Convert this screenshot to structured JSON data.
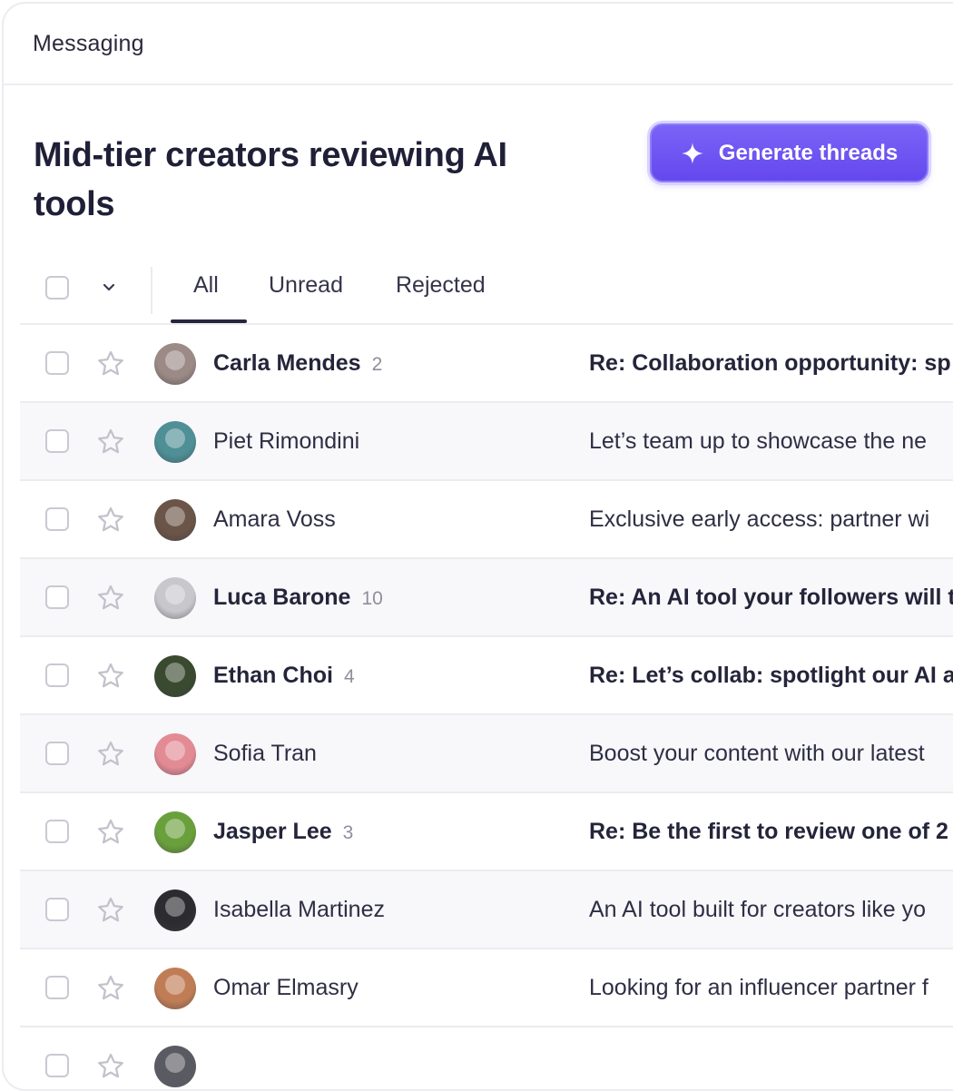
{
  "header": {
    "title": "Messaging"
  },
  "page": {
    "heading": "Mid-tier creators reviewing AI tools",
    "generate_label": "Generate threads"
  },
  "tabs": [
    {
      "label": "All",
      "active": true
    },
    {
      "label": "Unread",
      "active": false
    },
    {
      "label": "Rejected",
      "active": false
    }
  ],
  "accent": "#6a50f0",
  "threads": [
    {
      "name": "Carla Mendes",
      "count": "2",
      "unread": true,
      "subject": "Re: Collaboration opportunity: sp",
      "avatar_color": "#9b8a86"
    },
    {
      "name": "Piet Rimondini",
      "count": "",
      "unread": false,
      "subject": "Let’s team up to showcase the ne",
      "avatar_color": "#4f8f96"
    },
    {
      "name": "Amara Voss",
      "count": "",
      "unread": false,
      "subject": "Exclusive early access: partner wi",
      "avatar_color": "#6b5448"
    },
    {
      "name": "Luca Barone",
      "count": "10",
      "unread": true,
      "subject": "Re: An AI tool your followers will t",
      "avatar_color": "#c8c8cc"
    },
    {
      "name": "Ethan Choi",
      "count": "4",
      "unread": true,
      "subject": "Re: Let’s collab: spotlight our AI a",
      "avatar_color": "#3a4a30"
    },
    {
      "name": "Sofia Tran",
      "count": "",
      "unread": false,
      "subject": "Boost your content with our latest",
      "avatar_color": "#e38b95"
    },
    {
      "name": "Jasper Lee",
      "count": "3",
      "unread": true,
      "subject": "Re: Be the first to review one of 2",
      "avatar_color": "#6aa03c"
    },
    {
      "name": "Isabella Martinez",
      "count": "",
      "unread": false,
      "subject": "An AI tool built for creators like yo",
      "avatar_color": "#2c2c30"
    },
    {
      "name": "Omar Elmasry",
      "count": "",
      "unread": false,
      "subject": "Looking for an influencer partner f",
      "avatar_color": "#c07d55"
    }
  ]
}
